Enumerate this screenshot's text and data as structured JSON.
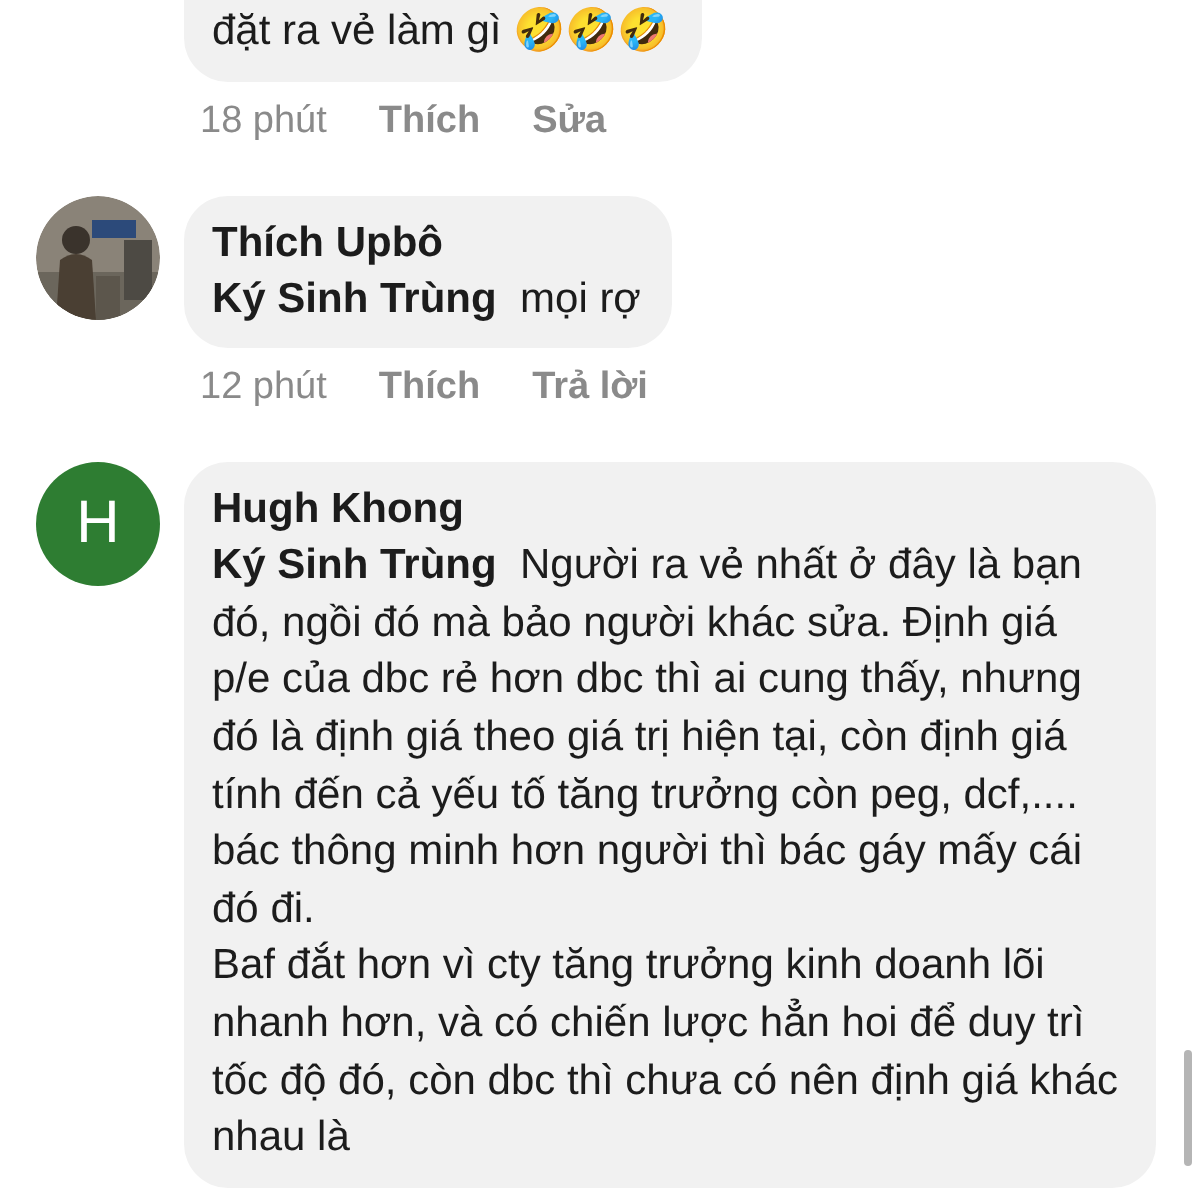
{
  "comments": [
    {
      "avatar": {
        "kind": "none"
      },
      "text": "đặt ra vẻ làm gì 🤣🤣🤣",
      "time": "18 phút",
      "actions": [
        "Thích",
        "Sửa"
      ]
    },
    {
      "avatar": {
        "kind": "picture"
      },
      "author": "Thích Upbô",
      "mention": "Ký Sinh Trùng",
      "text": "mọi rợ",
      "time": "12 phút",
      "actions": [
        "Thích",
        "Trả lời"
      ]
    },
    {
      "avatar": {
        "kind": "letter",
        "letter": "H",
        "color": "#2e7d32"
      },
      "author": "Hugh Khong",
      "mention": "Ký Sinh Trùng",
      "text": "Người ra vẻ nhất ở đây là bạn đó, ngồi đó mà bảo người khác sửa. Định giá p/e của dbc rẻ hơn dbc thì ai cung thấy, nhưng đó là định giá theo giá trị hiện tại, còn định giá tính đến cả yếu tố tăng trưởng còn peg, dcf,.... bác thông minh hơn người thì bác gáy mấy cái đó đi.\nBaf đắt hơn vì cty tăng trưởng kinh doanh lõi nhanh hơn, và có chiến lược hẳn hoi để duy trì tốc độ đó, còn dbc thì chưa có nên định giá khác nhau là"
    }
  ]
}
